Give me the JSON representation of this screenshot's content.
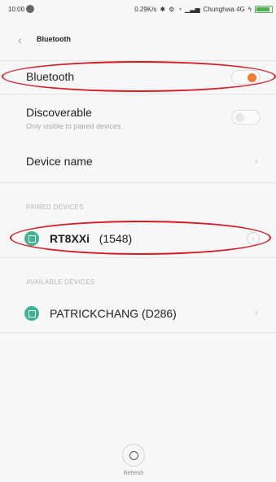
{
  "status_bar": {
    "time": "10:00",
    "net_speed": "0.29K/s",
    "carrier": "Chunghwa 4G"
  },
  "header": {
    "title": "Bluetooth"
  },
  "settings": {
    "bluetooth": {
      "label": "Bluetooth",
      "enabled": true
    },
    "discoverable": {
      "label": "Discoverable",
      "sub": "Only visible to paired devices",
      "enabled": false
    },
    "device_name": {
      "label": "Device name"
    }
  },
  "paired_devices": {
    "heading": "PAIRED DEVICES",
    "items": [
      {
        "name_bold": "RT8XXi",
        "name_rest": "(1548)"
      }
    ]
  },
  "available_devices": {
    "heading": "AVAILABLE DEVICES",
    "items": [
      {
        "name": "PATRICKCHANG (D286)"
      }
    ]
  },
  "footer": {
    "refresh_label": "Refresh"
  },
  "colors": {
    "accent": "#f07c2e",
    "device_icon": "#3fb58f",
    "annotation": "#d51a24"
  }
}
